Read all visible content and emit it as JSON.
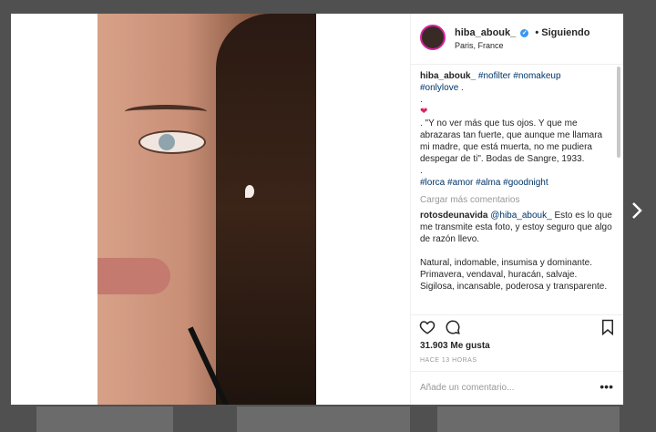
{
  "post": {
    "username": "hiba_abouk_",
    "follow_status": "• Siguiendo",
    "location": "Paris, France",
    "caption": {
      "username": "hiba_abouk_",
      "tags_line1": "#nofilter #nomakeup",
      "tags_line2": "#onlylove .",
      "dot1": ".",
      "heart": "❤",
      "quote": ". \"Y no ver más que tus ojos. Y que me abrazaras tan fuerte, que aunque me llamara mi madre, que está muerta, no me pudiera despegar de ti\". Bodas de Sangre, 1933.",
      "dot2": ".",
      "tags_line3": "#lorca #amor #alma #goodnight"
    },
    "load_more": "Cargar más comentarios",
    "comment": {
      "username": "rotosdeunavida",
      "mention": "@hiba_abouk_",
      "text1": " Esto es lo que me transmite esta foto, y estoy seguro que algo de razón llevo.",
      "text2": "Natural, indomable, insumisa y dominante.",
      "text3": "Primavera, vendaval, huracán, salvaje.",
      "text4": "Sigilosa, incansable, poderosa y transparente."
    },
    "likes": "31.903 Me gusta",
    "time": "HACE 13 HORAS",
    "add_comment_placeholder": "Añade un comentario...",
    "more_icon": "•••"
  },
  "icons": {
    "heart": "heart-icon",
    "comment": "comment-icon",
    "bookmark": "bookmark-icon",
    "next": "chevron-right-icon"
  },
  "colors": {
    "link": "#003569",
    "verified": "#3897f0",
    "muted": "#999999"
  }
}
